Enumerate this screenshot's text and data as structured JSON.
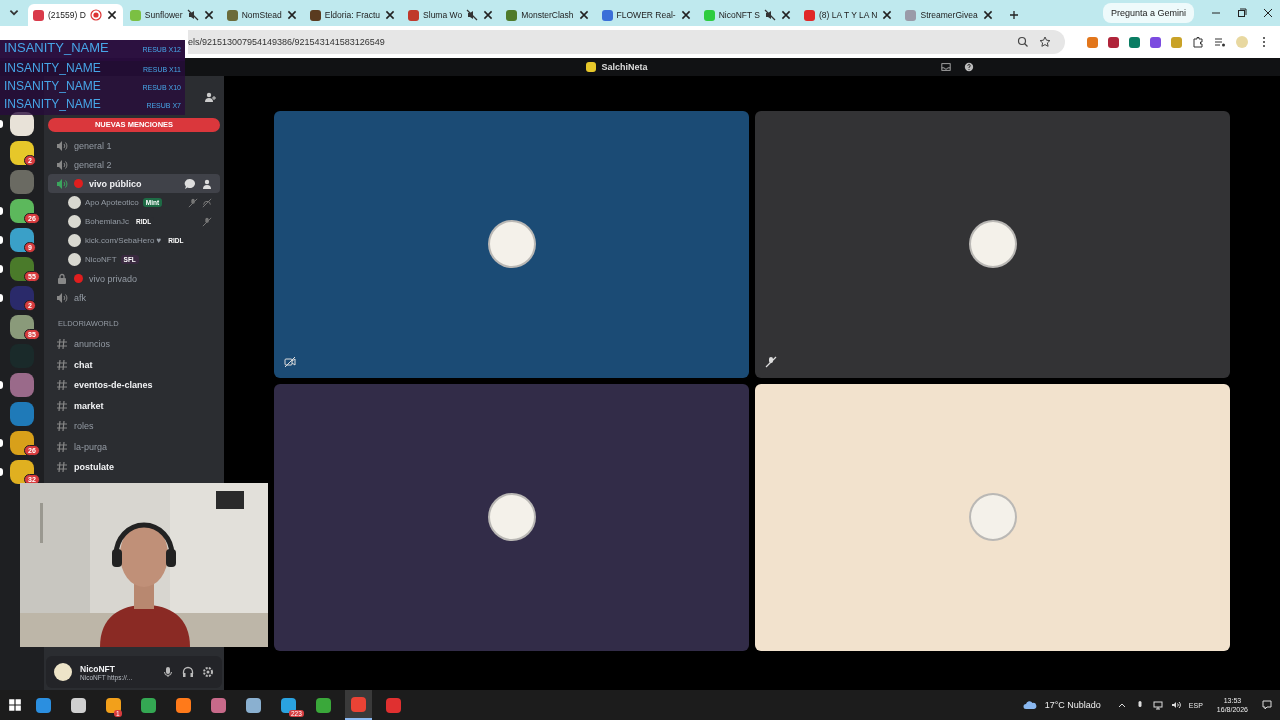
{
  "browser": {
    "tabs": [
      {
        "title": "(21559) D",
        "selected": true,
        "muted": false,
        "recording": true,
        "color": "#d93a4a"
      },
      {
        "title": "Sunflower",
        "selected": false,
        "muted": true,
        "recording": false,
        "color": "#7bc043"
      },
      {
        "title": "NomStead",
        "selected": false,
        "muted": false,
        "recording": false,
        "color": "#6b6b3a"
      },
      {
        "title": "Eldoria: Fractu",
        "selected": false,
        "muted": false,
        "recording": false,
        "color": "#5a3b1f"
      },
      {
        "title": "Sluma Wo",
        "selected": false,
        "muted": true,
        "recording": false,
        "color": "#c0392b"
      },
      {
        "title": "MonsterClash",
        "selected": false,
        "muted": false,
        "recording": false,
        "color": "#4f7a2a"
      },
      {
        "title": "FLOWER Real-",
        "selected": false,
        "muted": false,
        "recording": false,
        "color": "#3b6fd8"
      },
      {
        "title": "NicoNFT S",
        "selected": false,
        "muted": true,
        "recording": false,
        "color": "#2ecc40"
      },
      {
        "title": "(8) LA T Y LA N",
        "selected": false,
        "muted": false,
        "recording": false,
        "color": "#e02828"
      },
      {
        "title": "StreamerGivea",
        "selected": false,
        "muted": false,
        "recording": false,
        "color": "#9a9aa8"
      }
    ],
    "gemini_button": "Pregunta a Gemini",
    "url": "els/921513007954149386/921543141583126549",
    "extensions": [
      {
        "color": "#e2761b"
      },
      {
        "color": "#b0243a"
      },
      {
        "color": "#0a7d63"
      },
      {
        "color": "#7b4be0"
      },
      {
        "color": "#c9a227"
      }
    ]
  },
  "discord": {
    "title": "SalchiNeta",
    "mentions_banner": "NUEVAS MENCIONES",
    "servers": [
      {
        "color": "#e8e2d8",
        "unread": true
      },
      {
        "color": "#e6c72a",
        "badge": "2",
        "unread": false
      },
      {
        "color": "#6a6a62",
        "unread": false
      },
      {
        "color": "#5cb85c",
        "badge": "26",
        "unread": true
      },
      {
        "color": "#3aa0c8",
        "badge": "9",
        "unread": true
      },
      {
        "color": "#4a7a2a",
        "badge": "55",
        "unread": true
      },
      {
        "color": "#2a2a6a",
        "badge": "2",
        "unread": true
      },
      {
        "color": "#8a9a7a",
        "badge": "85",
        "unread": false
      },
      {
        "color": "#1a2a2a",
        "unread": false
      },
      {
        "color": "#9a6a8a",
        "unread": true
      },
      {
        "color": "#1f7ab8",
        "unread": false
      },
      {
        "color": "#d8a01a",
        "badge": "26",
        "unread": true
      },
      {
        "color": "#e0b020",
        "badge": "32",
        "unread": true
      }
    ],
    "channels": [
      {
        "kind": "voice",
        "name": "general 1",
        "selected": false,
        "live": false,
        "locked": false
      },
      {
        "kind": "voice",
        "name": "general 2",
        "selected": false,
        "live": false,
        "locked": false
      },
      {
        "kind": "voice",
        "name": "vivo público",
        "selected": true,
        "live": true,
        "locked": false,
        "members": [
          {
            "name": "Apo Apoteotico",
            "tag": "Mint",
            "color": "#1e6b45",
            "muted": true,
            "deafened": true
          },
          {
            "name": "BohemianJc",
            "tag": "RIDL",
            "color": "#2b2d31",
            "muted": true,
            "deafened": false
          },
          {
            "name": "kick.com/SebaHero ♥",
            "tag": "RIDL",
            "color": "#2b2d31",
            "muted": false,
            "deafened": false
          },
          {
            "name": "NicoNFT",
            "tag": "SFL",
            "color": "#3a2a40",
            "muted": false,
            "deafened": false
          }
        ]
      },
      {
        "kind": "voice",
        "name": "vivo privado",
        "selected": false,
        "live": true,
        "locked": true
      },
      {
        "kind": "voice",
        "name": "afk",
        "selected": false,
        "live": false,
        "locked": false
      },
      {
        "kind": "category",
        "name": "ELDORIAWORLD"
      },
      {
        "kind": "text",
        "name": "anuncios",
        "unread": false
      },
      {
        "kind": "text",
        "name": "chat",
        "unread": true
      },
      {
        "kind": "text",
        "name": "eventos-de-clanes",
        "unread": true
      },
      {
        "kind": "text",
        "name": "market",
        "unread": true
      },
      {
        "kind": "text",
        "name": "roles",
        "unread": false
      },
      {
        "kind": "text",
        "name": "la-purga",
        "unread": false
      },
      {
        "kind": "text",
        "name": "postulate",
        "unread": true
      }
    ],
    "user": {
      "name": "NicoNFT",
      "status": "NicoNFT https://..."
    },
    "tiles": [
      {
        "color": "#1b4b75",
        "camera_off": true,
        "muted": false
      },
      {
        "color": "#333335",
        "camera_off": false,
        "muted": true
      },
      {
        "color": "#322c48",
        "camera_off": false,
        "muted": false
      },
      {
        "color": "#f2e2cd",
        "camera_off": false,
        "muted": false
      }
    ]
  },
  "alerts": [
    {
      "name": "INSANITY_NAME",
      "label": "RESUB X12"
    },
    {
      "name": "INSANITY_NAME",
      "label": "RESUB X11"
    },
    {
      "name": "INSANITY_NAME",
      "label": "RESUB X10"
    },
    {
      "name": "INSANITY_NAME",
      "label": "RESUB X7"
    }
  ],
  "taskbar": {
    "apps": [
      {
        "color": "#2b8fe0",
        "selected": false
      },
      {
        "color": "#d0d0d0",
        "selected": false
      },
      {
        "color": "#f2a01b",
        "badge": "1",
        "selected": false
      },
      {
        "color": "#34a853",
        "selected": false
      },
      {
        "color": "#ff7a1a",
        "selected": false
      },
      {
        "color": "#c86a8a",
        "selected": false
      },
      {
        "color": "#8ab0d0",
        "selected": false
      },
      {
        "color": "#2aa3e0",
        "badge": "223",
        "selected": false
      },
      {
        "color": "#3aa83a",
        "selected": false
      },
      {
        "color": "#ea4335",
        "selected": true
      },
      {
        "color": "#e03030",
        "selected": false
      }
    ],
    "weather": "17°C Nublado",
    "language": "ESP",
    "time": "13:53",
    "date": "16/8/2026"
  }
}
